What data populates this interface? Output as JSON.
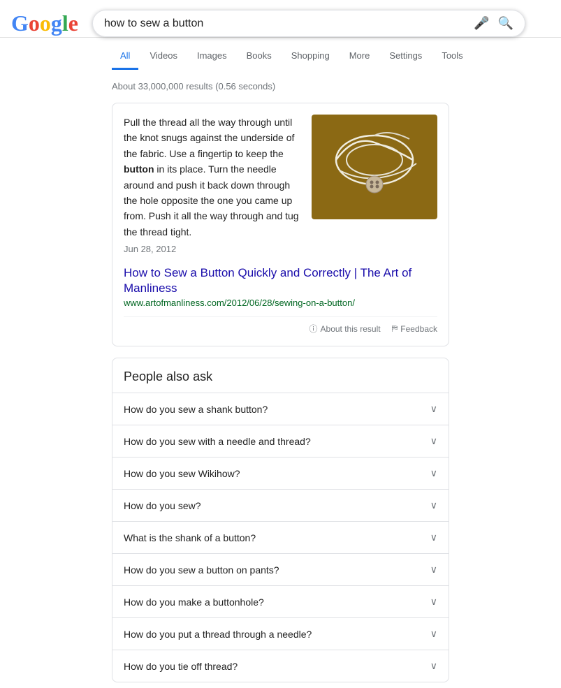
{
  "header": {
    "logo": {
      "letters": [
        {
          "char": "G",
          "color": "#4285F4"
        },
        {
          "char": "o",
          "color": "#EA4335"
        },
        {
          "char": "o",
          "color": "#FBBC05"
        },
        {
          "char": "g",
          "color": "#4285F4"
        },
        {
          "char": "l",
          "color": "#34A853"
        },
        {
          "char": "e",
          "color": "#EA4335"
        }
      ]
    },
    "search_query": "how to sew a button",
    "search_placeholder": "how to sew a button"
  },
  "nav": {
    "tabs": [
      {
        "label": "All",
        "active": true
      },
      {
        "label": "Videos",
        "active": false
      },
      {
        "label": "Images",
        "active": false
      },
      {
        "label": "Books",
        "active": false
      },
      {
        "label": "Shopping",
        "active": false
      },
      {
        "label": "More",
        "active": false
      }
    ],
    "right_tabs": [
      {
        "label": "Settings"
      },
      {
        "label": "Tools"
      }
    ]
  },
  "results_count": "About 33,000,000 results (0.56 seconds)",
  "featured_snippet": {
    "text_before_bold": "Pull the thread all the way through until the knot snugs against the underside of the fabric. Use a fingertip to keep the ",
    "bold_text": "button",
    "text_after_bold": " in its place. Turn the needle around and push it back down through the hole opposite the one you came up from. Push it all the way through and tug the thread tight.",
    "date": "Jun 28, 2012",
    "link_text": "How to Sew a Button Quickly and Correctly | The Art of Manliness",
    "url": "www.artofmanliness.com/2012/06/28/sewing-on-a-button/",
    "about_text": "About this result",
    "feedback_text": "Feedback"
  },
  "people_also_ask": {
    "title": "People also ask",
    "items": [
      {
        "question": "How do you sew a shank button?"
      },
      {
        "question": "How do you sew with a needle and thread?"
      },
      {
        "question": "How do you sew Wikihow?"
      },
      {
        "question": "How do you sew?"
      },
      {
        "question": "What is the shank of a button?"
      },
      {
        "question": "How do you sew a button on pants?"
      },
      {
        "question": "How do you make a buttonhole?"
      },
      {
        "question": "How do you put a thread through a needle?"
      },
      {
        "question": "How do you tie off thread?"
      }
    ]
  }
}
